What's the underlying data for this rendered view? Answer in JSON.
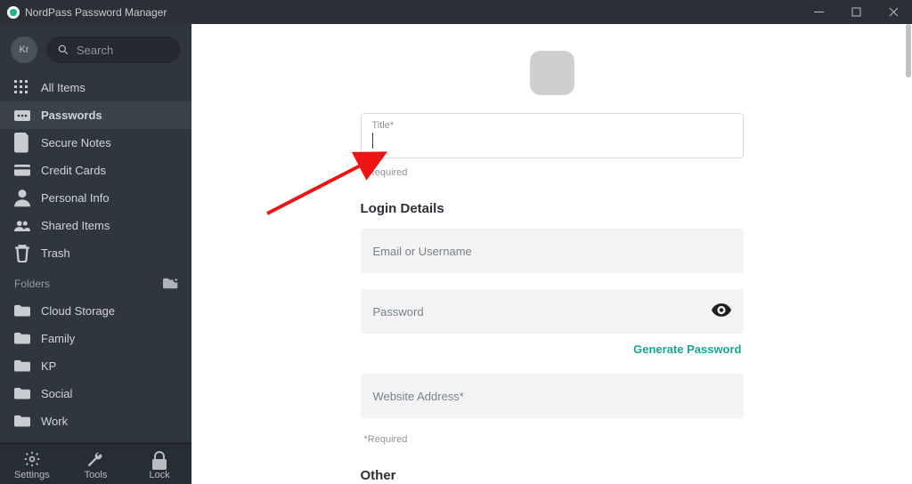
{
  "window": {
    "title": "NordPass Password Manager"
  },
  "sidebar": {
    "avatar": "Kr",
    "search_placeholder": "Search",
    "items": [
      {
        "label": "All Items",
        "icon": "grid-icon"
      },
      {
        "label": "Passwords",
        "icon": "password-icon"
      },
      {
        "label": "Secure Notes",
        "icon": "note-icon"
      },
      {
        "label": "Credit Cards",
        "icon": "card-icon"
      },
      {
        "label": "Personal Info",
        "icon": "person-icon"
      },
      {
        "label": "Shared Items",
        "icon": "people-icon"
      },
      {
        "label": "Trash",
        "icon": "trash-icon"
      }
    ],
    "folders_header": "Folders",
    "folders": [
      {
        "label": "Cloud Storage"
      },
      {
        "label": "Family"
      },
      {
        "label": "KP"
      },
      {
        "label": "Social"
      },
      {
        "label": "Work"
      }
    ],
    "bottom": {
      "settings": "Settings",
      "tools": "Tools",
      "lock": "Lock"
    }
  },
  "form": {
    "title_label": "Title*",
    "required": "*Required",
    "section_login": "Login Details",
    "email_ph": "Email or Username",
    "password_ph": "Password",
    "generate": "Generate Password",
    "website_ph": "Website Address*",
    "section_other": "Other"
  }
}
